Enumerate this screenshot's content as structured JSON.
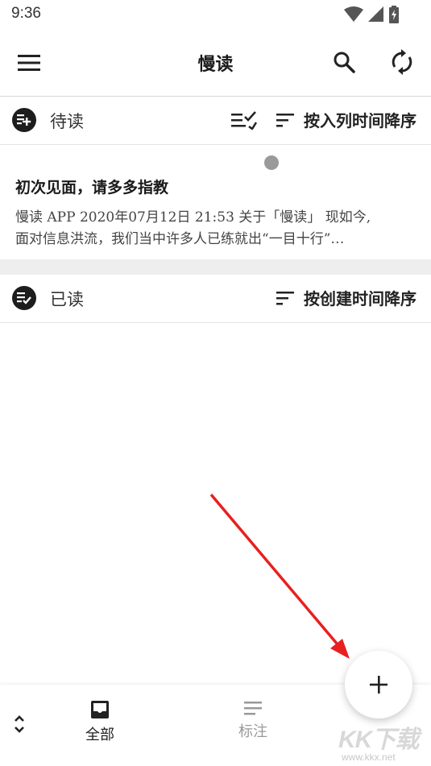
{
  "status_bar": {
    "time": "9:36"
  },
  "app_bar": {
    "title": "慢读"
  },
  "to_read": {
    "title": "待读",
    "sort_label": "按入列时间降序"
  },
  "article": {
    "title": "初次见面，请多多指教",
    "excerpt_line1": "慢读 APP 2020年07月12日 21:53 关于「慢读」 现如今,",
    "excerpt_line2": "面对信息洪流，我们当中许多人已练就出“一目十行”…"
  },
  "read": {
    "title": "已读",
    "sort_label": "按创建时间降序"
  },
  "bottom_nav": {
    "all_label": "全部",
    "annotations_label": "标注"
  },
  "watermark": {
    "brand": "KK下载",
    "url": "www.kkx.net"
  },
  "colors": {
    "annotation": "#e8201f",
    "accent": "#1d1d1d"
  }
}
